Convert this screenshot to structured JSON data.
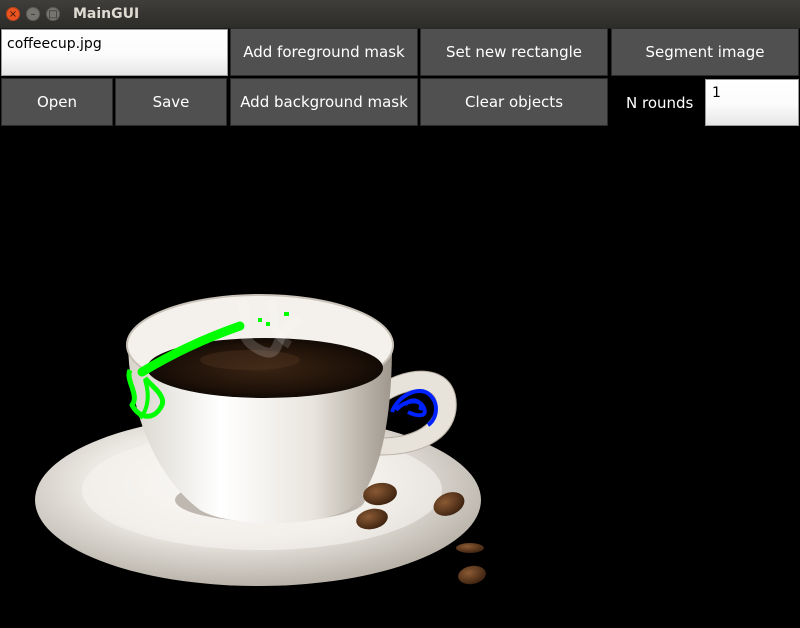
{
  "window": {
    "title": "MainGUI"
  },
  "toolbar": {
    "filename": "coffeecup.jpg",
    "open_label": "Open",
    "save_label": "Save",
    "add_foreground_label": "Add foreground mask",
    "add_background_label": "Add background mask",
    "set_rectangle_label": "Set new rectangle",
    "clear_objects_label": "Clear objects",
    "segment_label": "Segment image",
    "n_rounds_label": "N rounds",
    "n_rounds_value": "1"
  },
  "canvas": {
    "icon": "coffee-cup-image",
    "foreground_mask_color": "#00ff00",
    "background_mask_color": "#0000ff"
  }
}
